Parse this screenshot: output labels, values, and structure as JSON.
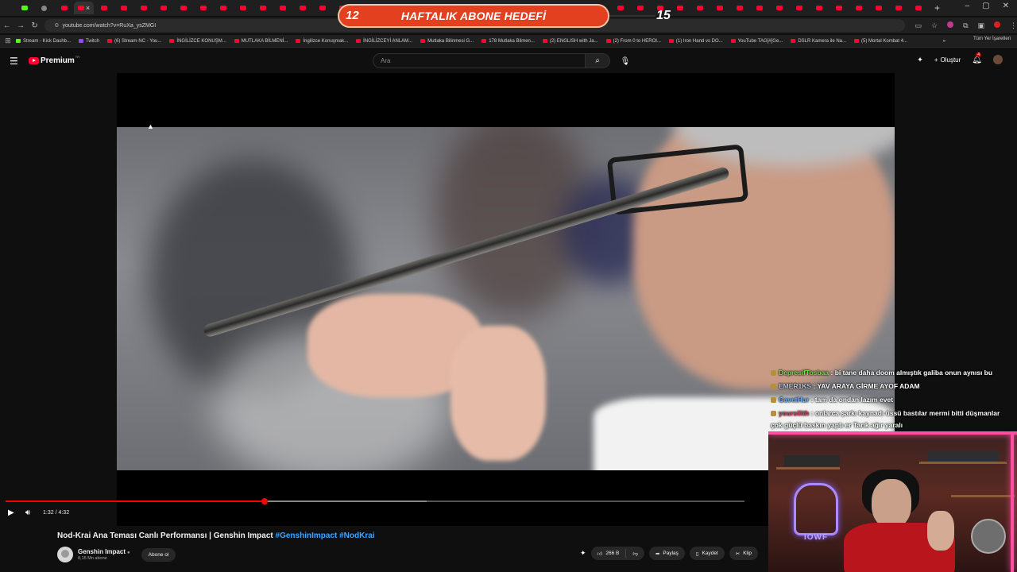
{
  "browser": {
    "active_tab_close": "×",
    "new_tab": "+",
    "window_controls": [
      "–",
      "▢",
      "✕"
    ],
    "url": "youtube.com/watch?v=RuXa_ysZMGI",
    "bookmarks": [
      {
        "label": "Stream - Kick Dashb...",
        "icon": "kick"
      },
      {
        "label": "Twitch",
        "icon": "twitch"
      },
      {
        "label": "(6) Stream-NC - You...",
        "icon": "youtube"
      },
      {
        "label": "İNGİLİZCE KONUŞM...",
        "icon": "youtube"
      },
      {
        "label": "MUTLAKA BİLMENİ...",
        "icon": "youtube"
      },
      {
        "label": "İngilizce Konuşmak...",
        "icon": "youtube"
      },
      {
        "label": "İNGİLİZCEYİ ANLAM...",
        "icon": "youtube"
      },
      {
        "label": "Mutlaka Bilinmesi G...",
        "icon": "youtube"
      },
      {
        "label": "178 Mutlaka Bilmen...",
        "icon": "youtube"
      },
      {
        "label": "(2) ENGLISH with Ja...",
        "icon": "youtube"
      },
      {
        "label": "(2) From 0 to HEROI...",
        "icon": "youtube"
      },
      {
        "label": "(1) Iron Hand vs DO...",
        "icon": "youtube"
      },
      {
        "label": "YouTube TAG[#]Ge...",
        "icon": "youtube"
      },
      {
        "label": "DSLR Kamera ile Na...",
        "icon": "youtube"
      },
      {
        "label": "(5) Mortal Kombat 4...",
        "icon": "youtube"
      }
    ],
    "bookmarks_more": "»",
    "all_bookmarks": "Tüm Yer İşaretleri"
  },
  "stream_overlay": {
    "goal_current": "12",
    "goal_title": "HAFTALIK ABONE HEDEFİ",
    "goal_target": "15"
  },
  "masthead": {
    "brand": "Premium",
    "brand_tr": "TR",
    "search_placeholder": "Ara",
    "create_label": "Oluştur",
    "notification_count": "4"
  },
  "player": {
    "progress_fraction": 0.35,
    "buffer_fraction": 0.57,
    "time_current": "1:32",
    "time_total": "4:32",
    "time_display": "1:32 / 4:32"
  },
  "video": {
    "title_text": "Nod-Krai Ana Teması Canlı Performansı | Genshin Impact",
    "hashtags": [
      "#GenshinImpact",
      "#NodKrai"
    ]
  },
  "channel": {
    "name": "Genshin Impact",
    "subscribers": "8,15 Mn abone",
    "subscribe_label": "Abone ol"
  },
  "actions": {
    "like_count": "266 B",
    "share_label": "Paylaş",
    "save_label": "Kaydet",
    "clip_label": "Klip"
  },
  "chat": [
    {
      "user": "DepresifTosbaa",
      "message": ": bi tane daha doom almıştık galiba onun aynısı bu",
      "color": "#7ed957"
    },
    {
      "user": "EMER1KS",
      "message": ": YAV ARAYA GİRME AYOF ADAM",
      "color": "#b8c7e0"
    },
    {
      "user": "GavetHur",
      "message": ": tam da ondan lazım evet",
      "color": "#6bb2ff"
    },
    {
      "user": "yoursilith",
      "message": ": onlarca şarkı kaynadı üssü bastılar mermi bitti düşmanlar çok güçlü baskın yaptı er Tarık ağır yaralı",
      "color": "#c4455d"
    }
  ],
  "webcam": {
    "neon_label": "IOWF"
  }
}
